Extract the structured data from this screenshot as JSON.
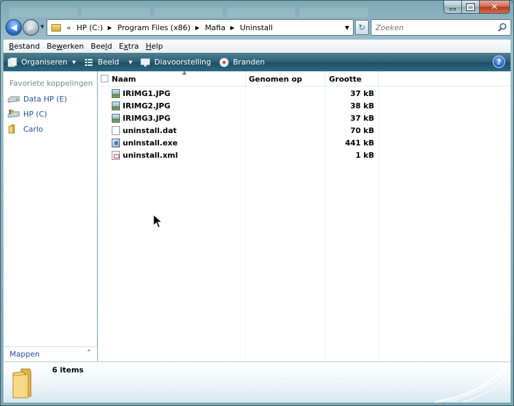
{
  "window": {
    "controls": {
      "minimize": "minimize",
      "maximize": "maximize",
      "close": "close"
    }
  },
  "address": {
    "crumbs": [
      "HP (C:)",
      "Program Files (x86)",
      "Mafia",
      "Uninstall"
    ],
    "chevron": "«"
  },
  "search": {
    "placeholder": "Zoeken"
  },
  "menu": {
    "items": [
      {
        "first": "B",
        "rest": "estand"
      },
      {
        "first": "B",
        "rest": "ewerken",
        "label_pre": "Be",
        "label_u": "w",
        "label_post": "erken"
      },
      {
        "first": "B",
        "rest": "eeld",
        "label_pre": "Bee",
        "label_u": "l",
        "label_post": "d"
      },
      {
        "first": "E",
        "rest": "xtra",
        "label_pre": "E",
        "label_u": "x",
        "label_post": "tra"
      },
      {
        "first": "H",
        "rest": "elp",
        "label_pre": "",
        "label_u": "H",
        "label_post": "elp"
      }
    ]
  },
  "commands": {
    "organize": "Organiseren",
    "view": "Beeld",
    "slideshow": "Diavoorstelling",
    "burn": "Branden",
    "help": "?"
  },
  "nav": {
    "favorites_heading": "Favoriete koppelingen",
    "favorites": [
      "Data HP (E)",
      "HP (C)",
      "Carlo"
    ],
    "folders_label": "Mappen"
  },
  "columns": {
    "name": "Naam",
    "date": "Genomen op",
    "size": "Grootte"
  },
  "files": [
    {
      "name": "IRIMG1.JPG",
      "size": "37 kB",
      "icon": "image-file-icon"
    },
    {
      "name": "IRIMG2.JPG",
      "size": "38 kB",
      "icon": "image-file-icon"
    },
    {
      "name": "IRIMG3.JPG",
      "size": "37 kB",
      "icon": "image-file-icon"
    },
    {
      "name": "uninstall.dat",
      "size": "70 kB",
      "icon": "document-file-icon"
    },
    {
      "name": "uninstall.exe",
      "size": "441 kB",
      "icon": "executable-file-icon"
    },
    {
      "name": "uninstall.xml",
      "size": "1 kB",
      "icon": "xml-file-icon"
    }
  ],
  "details": {
    "count": "6 items"
  }
}
